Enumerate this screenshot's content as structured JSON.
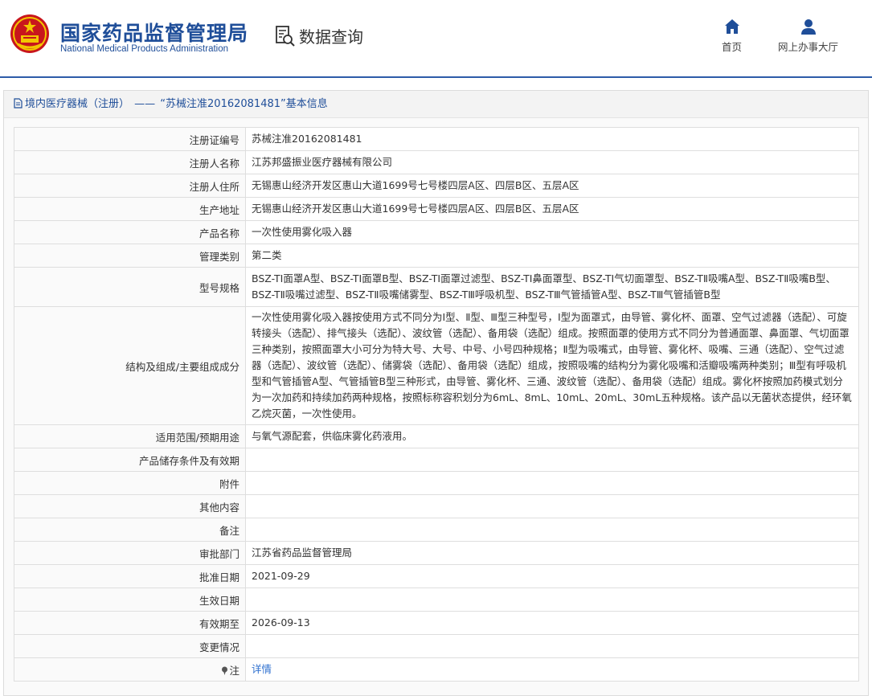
{
  "header": {
    "brand_cn": "国家药品监督管理局",
    "brand_en": "National Medical Products Administration",
    "query_label": "数据查询",
    "nav": [
      {
        "label": "首页",
        "icon": "home-icon"
      },
      {
        "label": "网上办事大厅",
        "icon": "user-icon"
      }
    ],
    "accent_color": "#1f4e99"
  },
  "panel": {
    "category": "境内医疗器械（注册）",
    "separator": "——",
    "record": "“苏械注准20162081481”基本信息"
  },
  "rows": [
    {
      "label": "注册证编号",
      "value": "苏械注准20162081481"
    },
    {
      "label": "注册人名称",
      "value": "江苏邦盛振业医疗器械有限公司"
    },
    {
      "label": "注册人住所",
      "value": "无锡惠山经济开发区惠山大道1699号七号楼四层A区、四层B区、五层A区"
    },
    {
      "label": "生产地址",
      "value": "无锡惠山经济开发区惠山大道1699号七号楼四层A区、四层B区、五层A区"
    },
    {
      "label": "产品名称",
      "value": "一次性使用雾化吸入器"
    },
    {
      "label": "管理类别",
      "value": "第二类"
    },
    {
      "label": "型号规格",
      "value": "BSZ-TⅠ面罩A型、BSZ-TⅠ面罩B型、BSZ-TⅠ面罩过滤型、BSZ-TⅠ鼻面罩型、BSZ-TⅠ气切面罩型、BSZ-TⅡ吸嘴A型、BSZ-TⅡ吸嘴B型、BSZ-TⅡ吸嘴过滤型、BSZ-TⅡ吸嘴储雾型、BSZ-TⅢ呼吸机型、BSZ-TⅢ气管插管A型、BSZ-TⅢ气管插管B型"
    },
    {
      "label": "结构及组成/主要组成成分",
      "value": "一次性使用雾化吸入器按使用方式不同分为Ⅰ型、Ⅱ型、Ⅲ型三种型号，Ⅰ型为面罩式，由导管、雾化杯、面罩、空气过滤器（选配）、可旋转接头（选配）、排气接头（选配）、波纹管（选配）、备用袋（选配）组成。按照面罩的使用方式不同分为普通面罩、鼻面罩、气切面罩三种类别，按照面罩大小可分为特大号、大号、中号、小号四种规格；Ⅱ型为吸嘴式，由导管、雾化杯、吸嘴、三通（选配）、空气过滤器（选配）、波纹管（选配）、储雾袋（选配）、备用袋（选配）组成，按照吸嘴的结构分为雾化吸嘴和活瓣吸嘴两种类别；Ⅲ型有呼吸机型和气管插管A型、气管插管B型三种形式，由导管、雾化杯、三通、波纹管（选配）、备用袋（选配）组成。雾化杯按照加药模式划分为一次加药和持续加药两种规格，按照标称容积划分为6mL、8mL、10mL、20mL、30mL五种规格。该产品以无菌状态提供，经环氧乙烷灭菌，一次性使用。"
    },
    {
      "label": "适用范围/预期用途",
      "value": "与氧气源配套，供临床雾化药液用。"
    },
    {
      "label": "产品储存条件及有效期",
      "value": ""
    },
    {
      "label": "附件",
      "value": ""
    },
    {
      "label": "其他内容",
      "value": ""
    },
    {
      "label": "备注",
      "value": ""
    },
    {
      "label": "审批部门",
      "value": "江苏省药品监督管理局"
    },
    {
      "label": "批准日期",
      "value": "2021-09-29"
    },
    {
      "label": "生效日期",
      "value": ""
    },
    {
      "label": "有效期至",
      "value": "2026-09-13"
    },
    {
      "label": "变更情况",
      "value": ""
    }
  ],
  "note_row": {
    "label": "注",
    "link": "详情",
    "icon": "pin-icon"
  }
}
